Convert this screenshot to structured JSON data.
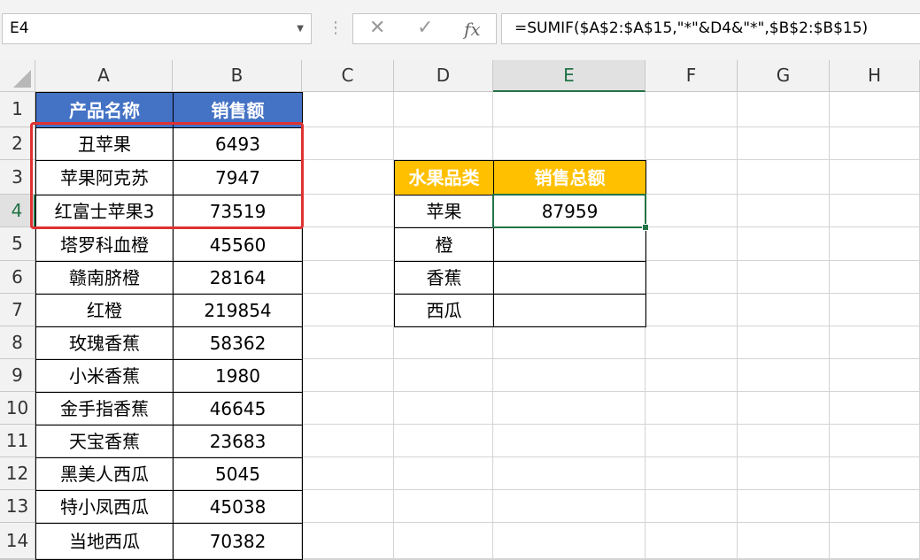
{
  "formula_bar": {
    "name_box": "E4",
    "cancel_icon": "✕",
    "enter_icon": "✓",
    "fx_label": "fx",
    "formula": "=SUMIF($A$2:$A$15,\"*\"&D4&\"*\",$B$2:$B$15)"
  },
  "columns": [
    "A",
    "B",
    "C",
    "D",
    "E",
    "F",
    "G",
    "H"
  ],
  "rows": [
    "1",
    "2",
    "3",
    "4",
    "5",
    "6",
    "7",
    "8",
    "9",
    "10",
    "11",
    "12",
    "13",
    "14"
  ],
  "table_left": {
    "header": [
      "产品名称",
      "销售额"
    ],
    "rows": [
      [
        "丑苹果",
        "6493"
      ],
      [
        "苹果阿克苏",
        "7947"
      ],
      [
        "红富士苹果3",
        "73519"
      ],
      [
        "塔罗科血橙",
        "45560"
      ],
      [
        "赣南脐橙",
        "28164"
      ],
      [
        "红橙",
        "219854"
      ],
      [
        "玫瑰香蕉",
        "58362"
      ],
      [
        "小米香蕉",
        "1980"
      ],
      [
        "金手指香蕉",
        "46645"
      ],
      [
        "天宝香蕉",
        "23683"
      ],
      [
        "黑美人西瓜",
        "5045"
      ],
      [
        "特小凤西瓜",
        "45038"
      ],
      [
        "当地西瓜",
        "70382"
      ]
    ]
  },
  "table_right": {
    "header": [
      "水果品类",
      "销售总额"
    ],
    "rows": [
      [
        "苹果",
        "87959"
      ],
      [
        "橙",
        ""
      ],
      [
        "香蕉",
        ""
      ],
      [
        "西瓜",
        ""
      ]
    ]
  },
  "selected_cell": "E4",
  "colors": {
    "header_blue": "#4472c4",
    "header_gold": "#ffc000",
    "selection_green": "#217346",
    "highlight_red": "#e03131"
  }
}
